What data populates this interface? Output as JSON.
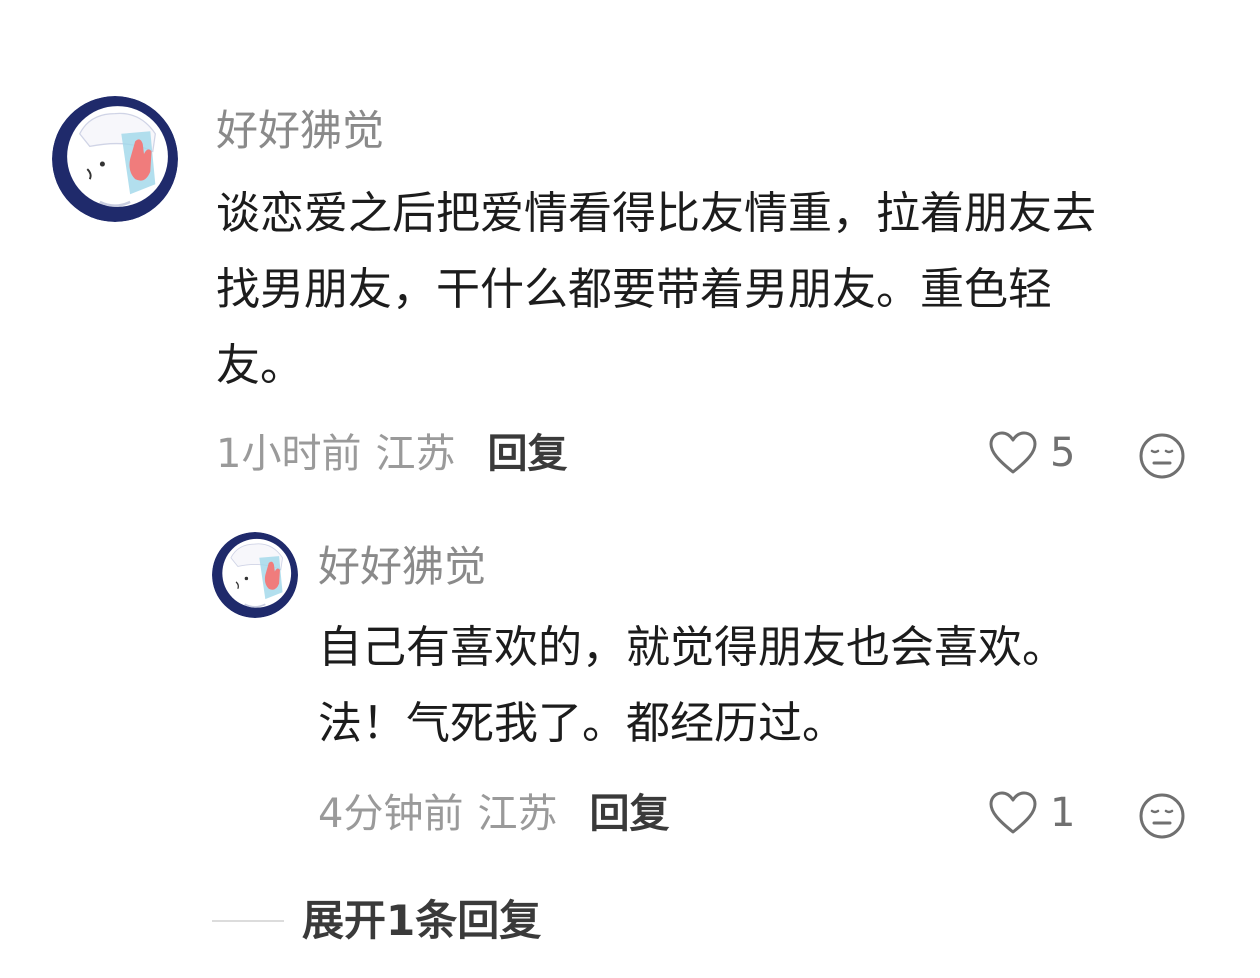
{
  "comments": [
    {
      "username": "好好狒觉",
      "content_lines": [
        "谈恋爱之后把爱情看得比友情重，拉着朋友去",
        "找男朋友，干什么都要带着男朋友。重色轻",
        "友。"
      ],
      "time": "1小时前",
      "location": "江苏",
      "reply_label": "回复",
      "like_count": "5",
      "avatar_icon": "cartoon-avatar-icon"
    },
    {
      "username": "好好狒觉",
      "content_lines": [
        "自己有喜欢的，就觉得朋友也会喜欢。",
        "法！气死我了。都经历过。"
      ],
      "time": "4分钟前",
      "location": "江苏",
      "reply_label": "回复",
      "like_count": "1",
      "avatar_icon": "cartoon-avatar-icon"
    }
  ],
  "expand_replies": {
    "label": "展开1条回复"
  },
  "colors": {
    "username": "#8a8a8a",
    "content": "#1c1c1c",
    "meta": "#9a9a9a",
    "action": "#3a3a3a",
    "icon": "#707070"
  }
}
